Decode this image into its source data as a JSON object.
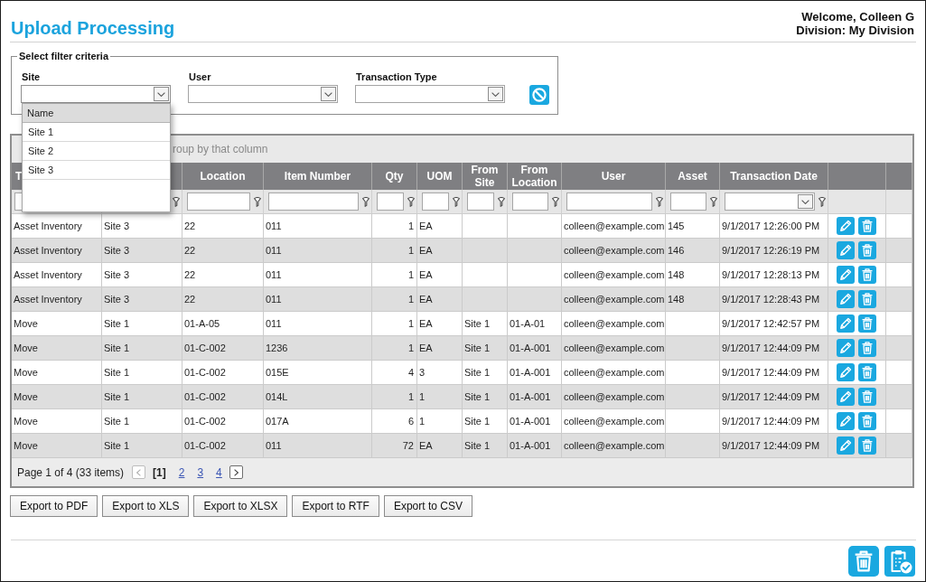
{
  "header": {
    "title": "Upload Processing",
    "welcome": "Welcome, Colleen G",
    "division": "Division: My Division"
  },
  "filters": {
    "legend": "Select filter criteria",
    "fields": [
      {
        "label": "Site",
        "expanded": true,
        "list_header": "Name",
        "options": [
          {
            "label": "Site 1",
            "selected": false
          },
          {
            "label": "Site 2",
            "selected": false
          },
          {
            "label": "Site 3",
            "selected": false
          }
        ]
      },
      {
        "label": "User",
        "expanded": false
      },
      {
        "label": "Transaction Type",
        "expanded": false
      }
    ]
  },
  "grid": {
    "group_panel": {
      "text": "roup by that column"
    },
    "columns": [
      {
        "label": "T",
        "kind": "text"
      },
      {
        "kind": "text"
      },
      {
        "label": "Location",
        "kind": "text"
      },
      {
        "label": "Item Number",
        "kind": "text"
      },
      {
        "label": "Qty",
        "kind": "number"
      },
      {
        "label": "UOM",
        "kind": "text"
      },
      {
        "label": "From Site",
        "kind": "text"
      },
      {
        "label": "From Location",
        "kind": "text"
      },
      {
        "label": "User",
        "kind": "text"
      },
      {
        "label": "Asset",
        "kind": "text"
      },
      {
        "label": "Transaction Date",
        "kind": "date"
      }
    ],
    "rows": [
      {
        "column_1": "Asset Inventory",
        "column_2": "Site 3",
        "location": "22",
        "item_number": "011",
        "qty": "1",
        "uom": "EA",
        "user": "colleen@example.com",
        "asset": "145",
        "transaction_date": "9/1/2017 12:26:00 PM"
      },
      {
        "column_1": "Asset Inventory",
        "column_2": "Site 3",
        "location": "22",
        "item_number": "011",
        "qty": "1",
        "uom": "EA",
        "user": "colleen@example.com",
        "asset": "146",
        "transaction_date": "9/1/2017 12:26:19 PM"
      },
      {
        "column_1": "Asset Inventory",
        "column_2": "Site 3",
        "location": "22",
        "item_number": "011",
        "qty": "1",
        "uom": "EA",
        "user": "colleen@example.com",
        "asset": "148",
        "transaction_date": "9/1/2017 12:28:13 PM"
      },
      {
        "column_1": "Asset Inventory",
        "column_2": "Site 3",
        "location": "22",
        "item_number": "011",
        "qty": "1",
        "uom": "EA",
        "user": "colleen@example.com",
        "asset": "148",
        "transaction_date": "9/1/2017 12:28:43 PM"
      },
      {
        "column_1": "Move",
        "column_2": "Site 1",
        "location": "01-A-05",
        "item_number": "011",
        "qty": "1",
        "uom": "EA",
        "from_site": "Site 1",
        "from_location": "01-A-01",
        "user": "colleen@example.com",
        "transaction_date": "9/1/2017 12:42:57 PM"
      },
      {
        "column_1": "Move",
        "column_2": "Site 1",
        "location": "01-C-002",
        "item_number": "1236",
        "qty": "1",
        "uom": "EA",
        "from_site": "Site 1",
        "from_location": "01-A-001",
        "user": "colleen@example.com",
        "transaction_date": "9/1/2017 12:44:09 PM"
      },
      {
        "column_1": "Move",
        "column_2": "Site 1",
        "location": "01-C-002",
        "item_number": "015E",
        "qty": "4",
        "uom": "3",
        "from_site": "Site 1",
        "from_location": "01-A-001",
        "user": "colleen@example.com",
        "transaction_date": "9/1/2017 12:44:09 PM"
      },
      {
        "column_1": "Move",
        "column_2": "Site 1",
        "location": "01-C-002",
        "item_number": "014L",
        "qty": "1",
        "uom": "1",
        "from_site": "Site 1",
        "from_location": "01-A-001",
        "user": "colleen@example.com",
        "transaction_date": "9/1/2017 12:44:09 PM"
      },
      {
        "column_1": "Move",
        "column_2": "Site 1",
        "location": "01-C-002",
        "item_number": "017A",
        "qty": "6",
        "uom": "1",
        "from_site": "Site 1",
        "from_location": "01-A-001",
        "user": "colleen@example.com",
        "transaction_date": "9/1/2017 12:44:09 PM"
      },
      {
        "column_1": "Move",
        "column_2": "Site 1",
        "location": "01-C-002",
        "item_number": "011",
        "qty": "72",
        "uom": "EA",
        "from_site": "Site 1",
        "from_location": "01-A-001",
        "user": "colleen@example.com",
        "transaction_date": "9/1/2017 12:44:09 PM"
      }
    ],
    "pager": {
      "summary": "Page 1 of 4 (33 items)",
      "prev": {
        "disabled": true
      },
      "next": {
        "disabled": false
      },
      "pages": [
        {
          "label": "[1]",
          "selected": true
        },
        {
          "label": "2",
          "selected": false
        },
        {
          "label": "3",
          "selected": false
        },
        {
          "label": "4",
          "selected": false
        }
      ]
    }
  },
  "exports": [
    "Export to PDF",
    "Export to XLS",
    "Export to XLSX",
    "Export to RTF",
    "Export to CSV"
  ]
}
